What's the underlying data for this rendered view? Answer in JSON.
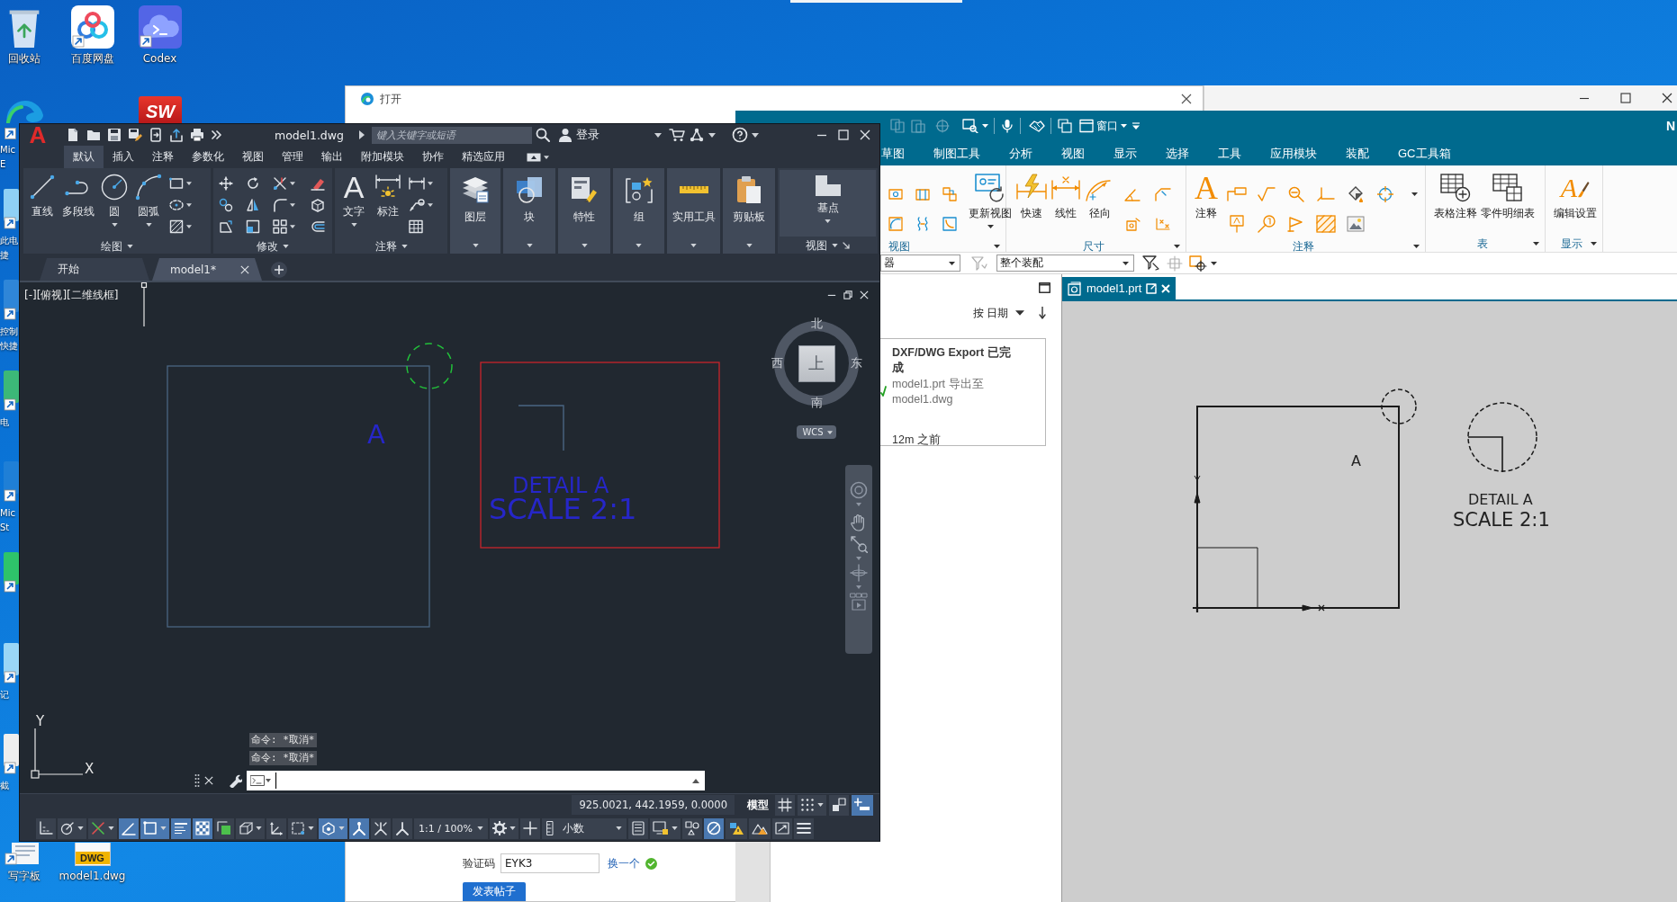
{
  "desktop": {
    "top_icons": [
      {
        "label": "回收站"
      },
      {
        "label": "百度网盘"
      },
      {
        "label": "Codex"
      }
    ],
    "partial_app_logo": "SW",
    "edge_icons": [
      {
        "kind": "labeled",
        "label": "Mic E"
      },
      {
        "kind": "labeled",
        "label": "此电捷"
      },
      {
        "kind": "labeled",
        "label": "控制快捷"
      },
      {
        "kind": "labeled",
        "label": "电"
      },
      {
        "kind": "labeled",
        "label": "Mic St"
      },
      {
        "kind": "bare"
      },
      {
        "kind": "labeled",
        "label": "记"
      },
      {
        "kind": "labeled",
        "label": "截"
      }
    ],
    "bottom_icons": [
      {
        "label": "写字板"
      },
      {
        "label": "model1.dwg",
        "badge": "DWG"
      }
    ]
  },
  "browser": {
    "title": "打开",
    "captcha_label": "验证码",
    "captcha_value": "EYK3",
    "refresh_link": "换一个",
    "submit_button": "发表帖子"
  },
  "nx": {
    "title_partial": "N",
    "quick_access": [
      {
        "disabled": true
      },
      {
        "disabled": true
      },
      {
        "disabled": true
      },
      {
        "disabled": false
      },
      {
        "disabled": false
      },
      {
        "disabled": false
      },
      {
        "disabled": false
      }
    ],
    "window_menu": "窗口",
    "ribbon_tabs": [
      {
        "label": "草图",
        "selected": false
      },
      {
        "label": "制图工具",
        "selected": false
      },
      {
        "label": "分析",
        "selected": false
      },
      {
        "label": "视图",
        "selected": false
      },
      {
        "label": "显示",
        "selected": false
      },
      {
        "label": "选择",
        "selected": false
      },
      {
        "label": "工具",
        "selected": false
      },
      {
        "label": "应用模块",
        "selected": false
      },
      {
        "label": "装配",
        "selected": false
      },
      {
        "label": "GC工具箱",
        "selected": false
      }
    ],
    "ribbon_groups": [
      {
        "label": "视图",
        "tools": [
          {
            "label": "更新视图"
          }
        ]
      },
      {
        "label": "尺寸",
        "tools": [
          {
            "label": "快速"
          },
          {
            "label": "线性"
          },
          {
            "label": "径向"
          }
        ]
      },
      {
        "label": "注释",
        "tools": [
          {
            "label": "注释",
            "glyph": "A"
          }
        ]
      },
      {
        "label": "表",
        "tools": [
          {
            "label": "表格注释"
          },
          {
            "label": "零件明细表"
          }
        ]
      },
      {
        "label": "显示",
        "tools": [
          {
            "label": "编辑设置",
            "glyph": "A"
          }
        ]
      }
    ],
    "type_filter": "器",
    "assembly_scope": "整个装配",
    "selection_tools": [
      {
        "disabled": true
      },
      {
        "disabled": false
      },
      {
        "disabled": true
      },
      {
        "disabled": false
      }
    ],
    "sort_label": "按 日期",
    "notification": {
      "title": "DXF/DWG Export 已完成",
      "message": "model1.prt 导出至 model1.dwg",
      "time": "12m 之前"
    },
    "document_tab": "model1.prt",
    "drawing": {
      "note": "A",
      "detail_title": "DETAIL A",
      "detail_scale": "SCALE 2:1"
    }
  },
  "autocad": {
    "logo": "A",
    "file_name": "model1.dwg",
    "search_placeholder": "键入关键字或短语",
    "sign_in": "登录",
    "ribbon_tabs": [
      {
        "label": "默认",
        "selected": true
      },
      {
        "label": "插入",
        "selected": false
      },
      {
        "label": "注释",
        "selected": false
      },
      {
        "label": "参数化",
        "selected": false
      },
      {
        "label": "视图",
        "selected": false
      },
      {
        "label": "管理",
        "selected": false
      },
      {
        "label": "输出",
        "selected": false
      },
      {
        "label": "附加模块",
        "selected": false
      },
      {
        "label": "协作",
        "selected": false
      },
      {
        "label": "精选应用",
        "selected": false
      }
    ],
    "ribbon_groups": [
      {
        "kind": "tools",
        "label": "绘图",
        "tools": [
          {
            "label": "直线",
            "menu": false
          },
          {
            "label": "多段线",
            "menu": false
          },
          {
            "label": "圆",
            "menu": true
          },
          {
            "label": "圆弧",
            "menu": true
          }
        ]
      },
      {
        "kind": "icons",
        "label": "修改"
      },
      {
        "kind": "tools",
        "label": "注释",
        "tools": [
          {
            "label": "文字",
            "glyph": "A",
            "menu": true
          },
          {
            "label": "标注",
            "menu": false
          }
        ]
      },
      {
        "kind": "panel",
        "label": "图层"
      },
      {
        "kind": "panel",
        "label": "块"
      },
      {
        "kind": "panel",
        "label": "特性"
      },
      {
        "kind": "panel",
        "label": "组"
      },
      {
        "kind": "panel",
        "label": "实用工具"
      },
      {
        "kind": "panel",
        "label": "剪贴板"
      },
      {
        "kind": "view",
        "label": "视图",
        "tools": [
          {
            "label": "基点",
            "menu": true
          }
        ]
      }
    ],
    "document_tabs": [
      {
        "label": "开始",
        "selected": false,
        "closable": false
      },
      {
        "label": "model1*",
        "selected": true,
        "closable": true
      }
    ],
    "viewport_label": "[-][俯视][二维线框]",
    "drawing": {
      "note": "A",
      "detail_title": "DETAIL A",
      "detail_scale": "SCALE 2:1"
    },
    "viewcube": {
      "top": "上",
      "north": "北",
      "south": "南",
      "west": "西",
      "east": "东",
      "ucs_menu": "WCS"
    },
    "ucs": {
      "x": "X",
      "y": "Y"
    },
    "command_history": [
      "命令: *取消*",
      "命令: *取消*"
    ],
    "status_bar": {
      "coordinates": "925.0021, 442.1959, 0.0000",
      "space": "模型",
      "top_toggles": [
        {
          "on": false,
          "menu": false
        },
        {
          "on": false,
          "menu": true
        },
        {
          "on": false,
          "menu": false
        },
        {
          "on": true,
          "menu": false
        }
      ],
      "items": [
        {
          "kind": "toggle",
          "on": false,
          "menu": false
        },
        {
          "kind": "toggle",
          "on": false,
          "menu": true
        },
        {
          "kind": "toggle",
          "on": false,
          "menu": true
        },
        {
          "kind": "toggle",
          "on": true,
          "menu": false
        },
        {
          "kind": "toggle",
          "on": true,
          "menu": true
        },
        {
          "kind": "toggle",
          "on": true,
          "menu": false
        },
        {
          "kind": "toggle",
          "on": true,
          "menu": false
        },
        {
          "kind": "toggle",
          "on": false,
          "menu": false
        },
        {
          "kind": "toggle",
          "on": false,
          "menu": true
        },
        {
          "kind": "toggle",
          "on": false,
          "menu": false
        },
        {
          "kind": "toggle",
          "on": false,
          "menu": true
        },
        {
          "kind": "toggle",
          "on": true,
          "menu": true
        },
        {
          "kind": "toggle",
          "on": true,
          "menu": false
        },
        {
          "kind": "toggle",
          "on": false,
          "menu": false
        },
        {
          "kind": "toggle",
          "on": false,
          "menu": false
        },
        {
          "kind": "scale",
          "label": "1:1 / 100%"
        },
        {
          "kind": "toggle",
          "on": false,
          "menu": true
        },
        {
          "kind": "toggle",
          "on": false,
          "menu": false
        },
        {
          "kind": "units",
          "label": "小数"
        },
        {
          "kind": "toggle",
          "on": false,
          "menu": false
        },
        {
          "kind": "toggle",
          "on": false,
          "menu": true
        },
        {
          "kind": "toggle",
          "on": false,
          "menu": false
        },
        {
          "kind": "toggle",
          "on": true,
          "menu": false
        },
        {
          "kind": "toggle",
          "on": false,
          "menu": false
        },
        {
          "kind": "toggle",
          "on": false,
          "menu": false
        },
        {
          "kind": "toggle",
          "on": false,
          "menu": false
        },
        {
          "kind": "toggle",
          "on": false,
          "menu": false
        }
      ]
    }
  }
}
